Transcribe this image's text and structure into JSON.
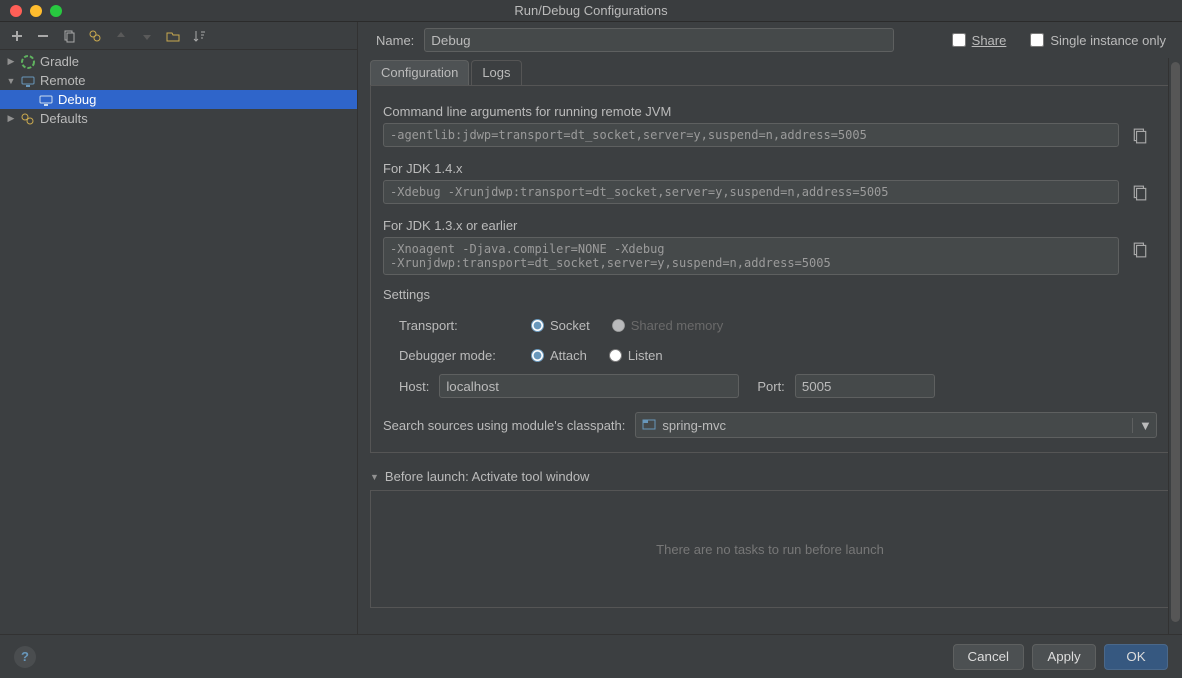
{
  "window": {
    "title": "Run/Debug Configurations"
  },
  "toolbar": {
    "add": "+",
    "remove": "−"
  },
  "tree": {
    "items": [
      {
        "label": "Gradle",
        "expanded": false,
        "iconColor": "#5fb35f"
      },
      {
        "label": "Remote",
        "expanded": true
      },
      {
        "label": "Debug",
        "selected": true
      },
      {
        "label": "Defaults",
        "expanded": false
      }
    ]
  },
  "header": {
    "name_label": "Name:",
    "name_value": "Debug",
    "share_label": "Share",
    "single_instance_label": "Single instance only"
  },
  "tabs": [
    {
      "label": "Configuration",
      "active": true
    },
    {
      "label": "Logs",
      "active": false
    }
  ],
  "config": {
    "cmd_label": "Command line arguments for running remote JVM",
    "cmd_value": "-agentlib:jdwp=transport=dt_socket,server=y,suspend=n,address=5005",
    "jdk14_label": "For JDK 1.4.x",
    "jdk14_value": "-Xdebug -Xrunjdwp:transport=dt_socket,server=y,suspend=n,address=5005",
    "jdk13_label": "For JDK 1.3.x or earlier",
    "jdk13_value": "-Xnoagent -Djava.compiler=NONE -Xdebug\n-Xrunjdwp:transport=dt_socket,server=y,suspend=n,address=5005",
    "settings_label": "Settings",
    "transport_label": "Transport:",
    "transport_socket": "Socket",
    "transport_shared": "Shared memory",
    "debugger_mode_label": "Debugger mode:",
    "mode_attach": "Attach",
    "mode_listen": "Listen",
    "host_label": "Host:",
    "host_value": "localhost",
    "port_label": "Port:",
    "port_value": "5005",
    "module_label": "Search sources using module's classpath:",
    "module_value": "spring-mvc"
  },
  "before_launch": {
    "header": "Before launch: Activate tool window",
    "empty_text": "There are no tasks to run before launch"
  },
  "footer": {
    "cancel": "Cancel",
    "apply": "Apply",
    "ok": "OK"
  }
}
